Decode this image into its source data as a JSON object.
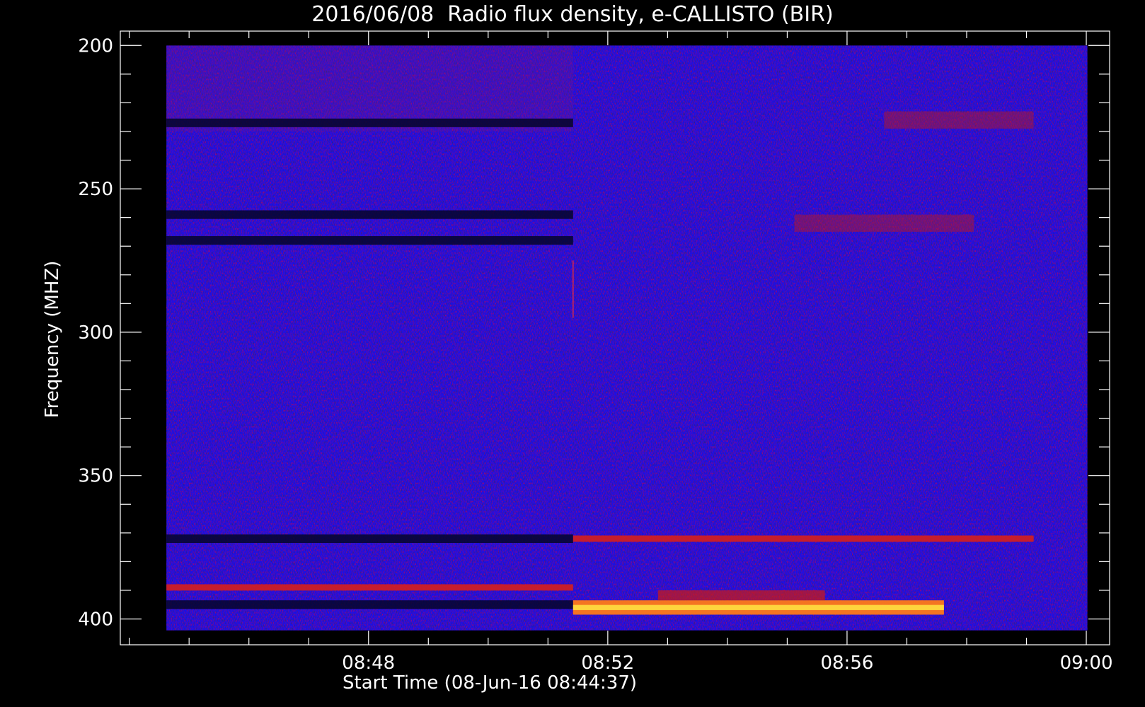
{
  "chart_data": {
    "type": "heatmap",
    "title": "2016/06/08  Radio flux density, e-CALLISTO (BIR)",
    "xlabel": "Start Time (08-Jun-16 08:44:37)",
    "ylabel": "Frequency (MHZ)",
    "x_ticks": [
      "08:48",
      "08:52",
      "08:56",
      "09:00"
    ],
    "x_tick_values_min": [
      3.38,
      7.38,
      11.38,
      15.38
    ],
    "x_range_min": [
      0,
      15.4
    ],
    "xlim_min": [
      -0.77,
      15.77
    ],
    "y_ticks": [
      "200",
      "250",
      "300",
      "350",
      "400"
    ],
    "y_tick_values": [
      200,
      250,
      300,
      350,
      400
    ],
    "ylim": [
      195,
      409
    ],
    "y_range": [
      200,
      404
    ],
    "y_inverted": true,
    "colormap": [
      "#000000",
      "#0a0a3c",
      "#1a10c8",
      "#2a18ff",
      "#7a1a9a",
      "#b41414",
      "#e03010",
      "#ff8020",
      "#ffe040"
    ],
    "background": "#1a10e6",
    "data_break_min": 6.8,
    "features": [
      {
        "label": "dark band",
        "freq_mhz": 227,
        "t_start_min": 0,
        "t_end_min": 6.8
      },
      {
        "label": "dark band",
        "freq_mhz": 259,
        "t_start_min": 0,
        "t_end_min": 6.8
      },
      {
        "label": "dark band",
        "freq_mhz": 268,
        "t_start_min": 0,
        "t_end_min": 6.8
      },
      {
        "label": "dark band",
        "freq_mhz": 372,
        "t_start_min": 0,
        "t_end_min": 6.8
      },
      {
        "label": "red band",
        "freq_mhz": 372,
        "t_start_min": 6.8,
        "t_end_min": 14.5
      },
      {
        "label": "red band",
        "freq_mhz": 389,
        "t_start_min": 0,
        "t_end_min": 6.8
      },
      {
        "label": "dark band",
        "freq_mhz": 395,
        "t_start_min": 0,
        "t_end_min": 6.8
      },
      {
        "label": "bright band",
        "freq_mhz": 396,
        "t_start_min": 6.8,
        "t_end_min": 13.0
      },
      {
        "label": "red patches",
        "freq_mhz": 226,
        "t_start_min": 12.0,
        "t_end_min": 14.5
      },
      {
        "label": "red patches",
        "freq_mhz": 262,
        "t_start_min": 10.5,
        "t_end_min": 13.5
      }
    ]
  }
}
